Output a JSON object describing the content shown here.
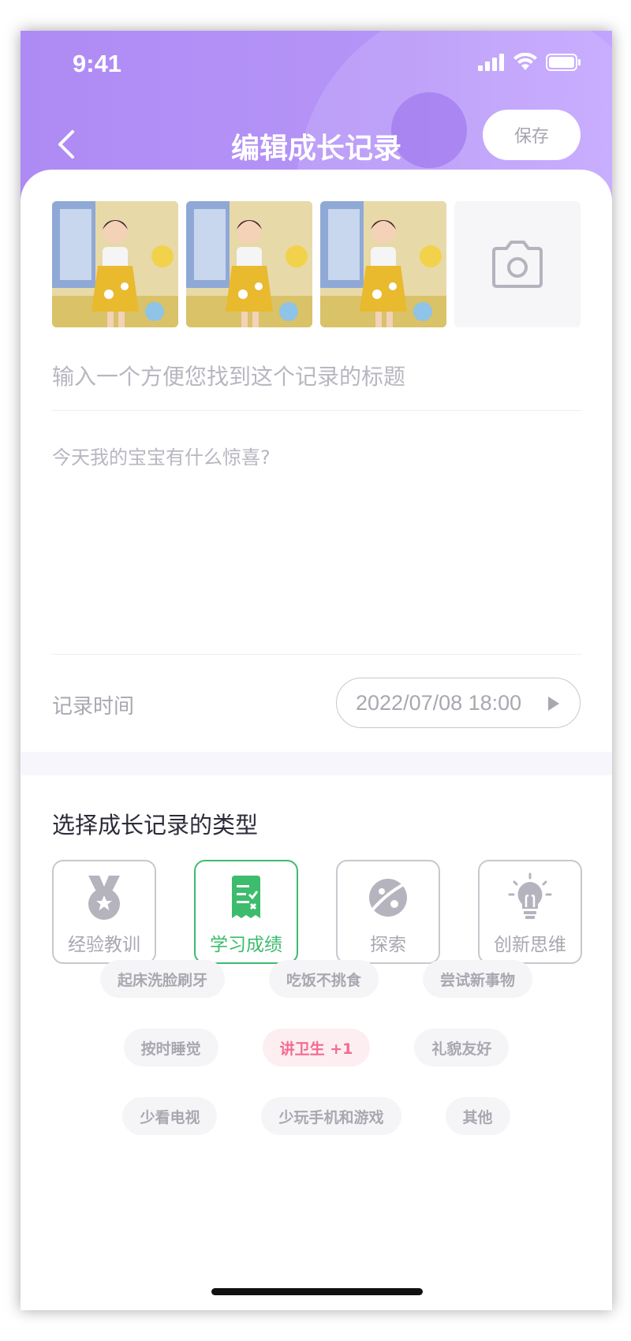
{
  "status_bar": {
    "time": "9:41"
  },
  "nav": {
    "title": "编辑成长记录",
    "save_label": "保存"
  },
  "form": {
    "title_placeholder": "输入一个方便您找到这个记录的标题",
    "description_placeholder": "今天我的宝宝有什么惊喜?",
    "record_time_label": "记录时间",
    "record_time_value": "2022/07/08 18:00"
  },
  "types": {
    "heading": "选择成长记录的类型",
    "items": [
      {
        "label": "经验教训",
        "icon": "medal-icon",
        "selected": false
      },
      {
        "label": "学习成绩",
        "icon": "report-card-icon",
        "selected": true
      },
      {
        "label": "探索",
        "icon": "planet-icon",
        "selected": false
      },
      {
        "label": "创新思维",
        "icon": "lightbulb-icon",
        "selected": false
      }
    ]
  },
  "tags": [
    [
      "起床洗脸刷牙",
      "吃饭不挑食",
      "尝试新事物"
    ],
    [
      "按时睡觉",
      "讲卫生  +1",
      "礼貌友好"
    ],
    [
      "少看电视",
      "少玩手机和游戏",
      "其他"
    ]
  ],
  "colors": {
    "header": "#b594f7",
    "selected_type": "#3cbc6c",
    "active_tag_text": "#f26b92",
    "active_tag_bg": "#fdeef2"
  }
}
